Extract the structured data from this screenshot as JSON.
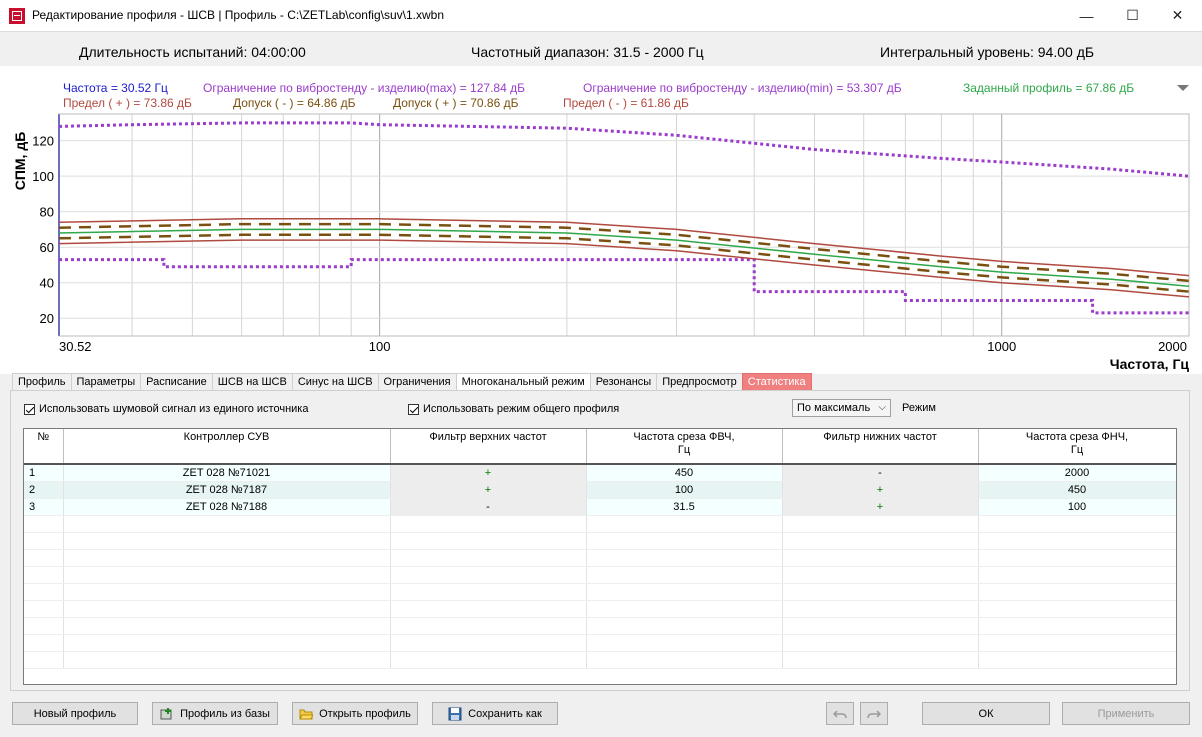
{
  "window": {
    "title": "Редактирование профиля - ШСВ | Профиль - C:\\ZETLab\\config\\suv\\1.xwbn",
    "min_glyph": "—",
    "max_glyph": "☐",
    "close_glyph": "✕"
  },
  "info": {
    "duration": "Длительность испытаний: 04:00:00",
    "range": "Частотный диапазон: 31.5 - 2000  Гц",
    "level": "Интегральный уровень: 94.00 дБ"
  },
  "chart_data": {
    "type": "line",
    "x_scale": "log",
    "xlim": [
      30.52,
      2000
    ],
    "ylim": [
      10,
      135
    ],
    "xlabel": "Частота, Гц",
    "ylabel": "СПМ, дБ",
    "x_ticks": [
      "30.52",
      "100",
      "1000",
      "2000"
    ],
    "y_ticks": [
      "20",
      "40",
      "60",
      "80",
      "100",
      "120"
    ],
    "grid": true,
    "legend": {
      "placement": "top",
      "entries": [
        {
          "text": "Частота = 30.52 Гц",
          "color": "#1a1ad0"
        },
        {
          "text": "Ограничение по вибростенду - изделию(max)  = 127.84 дБ",
          "color": "#9a3ccc"
        },
        {
          "text": "Ограничение по вибростенду - изделию(min)  = 53.307 дБ",
          "color": "#9a3ccc"
        },
        {
          "text": "Заданный профиль  = 67.86 дБ",
          "color": "#2ea84a"
        },
        {
          "text": "Предел ( + )  = 73.86 дБ",
          "color": "#b04a40"
        },
        {
          "text": "Допуск ( - )  = 64.86 дБ",
          "color": "#7a5010"
        },
        {
          "text": "Допуск ( + )  = 70.86 дБ",
          "color": "#7a5010"
        },
        {
          "text": "Предел ( - )  = 61.86 дБ",
          "color": "#b04a40"
        }
      ]
    },
    "series": [
      {
        "name": "Ограничение по вибростенду - изделию(max)",
        "color": "#9a3ccc",
        "style": "dotted",
        "x": [
          30.52,
          40,
          60,
          90,
          100,
          200,
          300,
          500,
          800,
          1000,
          1500,
          2000
        ],
        "y": [
          128,
          129,
          130,
          130,
          129,
          127,
          123,
          115,
          110,
          108,
          104,
          100
        ]
      },
      {
        "name": "Ограничение по вибростенду - изделию(min)",
        "color": "#9a3ccc",
        "style": "dotted-step",
        "x": [
          30.52,
          45,
          45,
          90,
          90,
          400,
          400,
          700,
          700,
          1400,
          1400,
          2000
        ],
        "y": [
          53,
          53,
          49,
          49,
          53,
          53,
          35,
          35,
          30,
          30,
          23,
          23
        ]
      },
      {
        "name": "Заданный профиль",
        "color": "#2ea84a",
        "style": "solid",
        "x": [
          30.52,
          60,
          100,
          200,
          300,
          500,
          800,
          1000,
          1500,
          2000
        ],
        "y": [
          68,
          70,
          70,
          68,
          64,
          56,
          49,
          46,
          42,
          38
        ]
      },
      {
        "name": "Предел ( + )",
        "color": "#b04a40",
        "style": "solid",
        "x": [
          30.52,
          60,
          100,
          200,
          300,
          500,
          800,
          1000,
          1500,
          2000
        ],
        "y": [
          74,
          76,
          76,
          74,
          70,
          62,
          55,
          52,
          48,
          44
        ]
      },
      {
        "name": "Предел ( - )",
        "color": "#b04a40",
        "style": "solid",
        "x": [
          30.52,
          60,
          100,
          200,
          300,
          500,
          800,
          1000,
          1500,
          2000
        ],
        "y": [
          62,
          64,
          64,
          62,
          58,
          50,
          43,
          40,
          36,
          32
        ]
      },
      {
        "name": "Допуск ( + )",
        "color": "#7a5010",
        "style": "dashed",
        "x": [
          30.52,
          60,
          100,
          200,
          300,
          500,
          800,
          1000,
          1500,
          2000
        ],
        "y": [
          71,
          73,
          73,
          71,
          67,
          59,
          52,
          49,
          45,
          41
        ]
      },
      {
        "name": "Допуск ( - )",
        "color": "#7a5010",
        "style": "dashed",
        "x": [
          30.52,
          60,
          100,
          200,
          300,
          500,
          800,
          1000,
          1500,
          2000
        ],
        "y": [
          65,
          67,
          67,
          65,
          61,
          53,
          46,
          43,
          39,
          35
        ]
      }
    ]
  },
  "tabs": [
    {
      "label": "Профиль"
    },
    {
      "label": "Параметры"
    },
    {
      "label": "Расписание"
    },
    {
      "label": "ШСВ на ШСВ"
    },
    {
      "label": "Синус на ШСВ"
    },
    {
      "label": "Ограничения"
    },
    {
      "label": "Многоканальный режим",
      "active": true
    },
    {
      "label": "Резонансы"
    },
    {
      "label": "Предпросмотр"
    },
    {
      "label": "Статистика",
      "highlight": "#f08080"
    }
  ],
  "options": {
    "single_source": "Использовать шумовой сигнал из единого источника",
    "common_profile": "Использовать режим общего профиля",
    "mode_value": "По максималь",
    "mode_label": "Режим"
  },
  "table": {
    "headers": [
      "№",
      "Контроллер СУВ",
      "Фильтр верхних частот",
      "Частота среза ФВЧ,\nГц",
      "Фильтр нижних частот",
      "Частота среза ФНЧ,\nГц"
    ],
    "rows": [
      [
        "1",
        "ZET 028 №71021",
        "+",
        "450",
        "-",
        "2000"
      ],
      [
        "2",
        "ZET 028 №7187",
        "+",
        "100",
        "+",
        "450"
      ],
      [
        "3",
        "ZET 028 №7188",
        "-",
        "31.5",
        "+",
        "100"
      ]
    ]
  },
  "buttons": {
    "new_profile": "Новый профиль",
    "from_base": "Профиль из базы",
    "open_profile": "Открыть профиль",
    "save_as": "Сохранить как",
    "ok": "ОК",
    "apply": "Применить"
  }
}
